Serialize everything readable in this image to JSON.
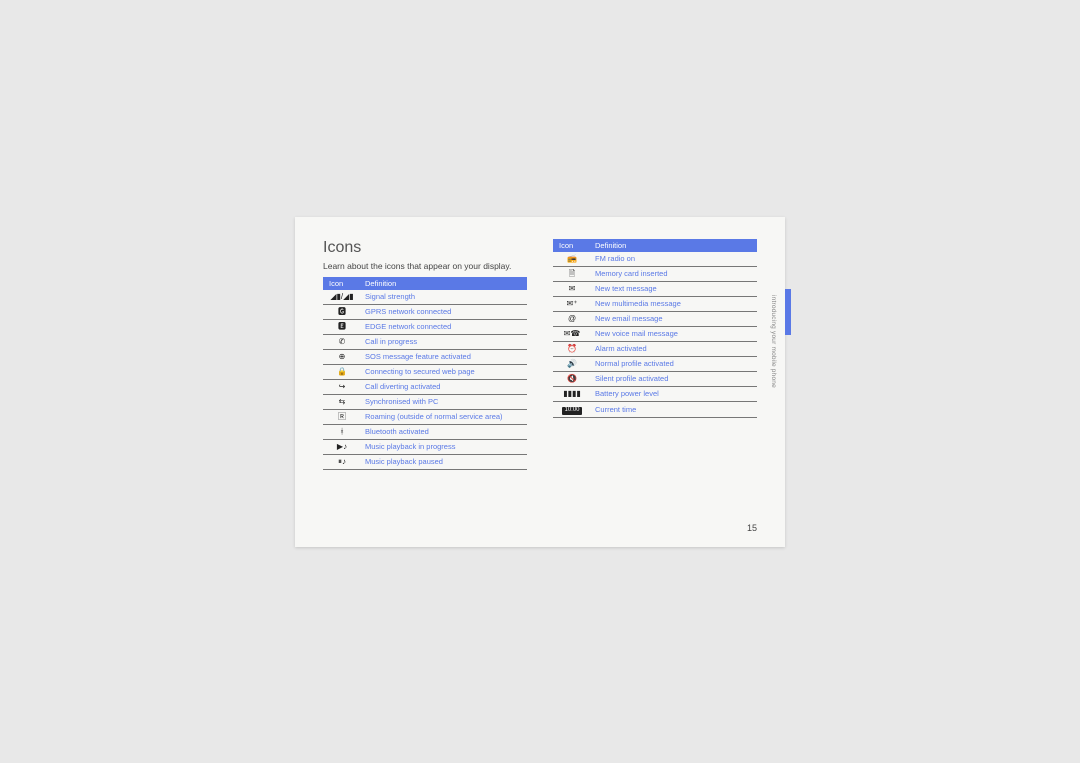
{
  "heading": "Icons",
  "subhead": "Learn about the icons that appear on your display.",
  "headers": {
    "icon": "Icon",
    "definition": "Definition"
  },
  "left_table": [
    {
      "icon": "signal-icon",
      "glyph": "◢▮/◢▮",
      "def": "Signal strength"
    },
    {
      "icon": "gprs-icon",
      "glyph": "🅶",
      "def": "GPRS network connected"
    },
    {
      "icon": "edge-icon",
      "glyph": "🅴",
      "def": "EDGE network connected"
    },
    {
      "icon": "call-icon",
      "glyph": "✆",
      "def": "Call in progress"
    },
    {
      "icon": "sos-icon",
      "glyph": "⊕",
      "def": "SOS message feature activated"
    },
    {
      "icon": "secure-icon",
      "glyph": "🔒",
      "def": "Connecting to secured web page"
    },
    {
      "icon": "divert-icon",
      "glyph": "↪",
      "def": "Call diverting activated"
    },
    {
      "icon": "sync-icon",
      "glyph": "⇆",
      "def": "Synchronised with PC"
    },
    {
      "icon": "roaming-icon",
      "glyph": "🅁",
      "def": "Roaming (outside of normal service area)"
    },
    {
      "icon": "bluetooth-icon",
      "glyph": "ᚼ",
      "def": "Bluetooth activated"
    },
    {
      "icon": "music-play-icon",
      "glyph": "▶♪",
      "def": "Music playback in progress"
    },
    {
      "icon": "music-pause-icon",
      "glyph": "⏸♪",
      "def": "Music playback paused"
    }
  ],
  "right_table": [
    {
      "icon": "radio-icon",
      "glyph": "📻",
      "def": "FM radio on"
    },
    {
      "icon": "memory-icon",
      "glyph": "🗎",
      "def": "Memory card inserted"
    },
    {
      "icon": "text-msg-icon",
      "glyph": "✉",
      "def": "New text message"
    },
    {
      "icon": "mms-icon",
      "glyph": "✉⁺",
      "def": "New multimedia message"
    },
    {
      "icon": "email-icon",
      "glyph": "@",
      "def": "New email message"
    },
    {
      "icon": "voicemail-icon",
      "glyph": "✉☎",
      "def": "New voice mail message"
    },
    {
      "icon": "alarm-icon",
      "glyph": "⏰",
      "def": "Alarm activated"
    },
    {
      "icon": "normal-prof-icon",
      "glyph": "🔊",
      "def": "Normal profile activated"
    },
    {
      "icon": "silent-prof-icon",
      "glyph": "🔇",
      "def": "Silent profile activated"
    },
    {
      "icon": "battery-icon",
      "glyph": "▮▮▮▮",
      "def": "Battery power level"
    },
    {
      "icon": "time-icon",
      "glyph": "10:00",
      "def": "Current time",
      "time_box": true
    }
  ],
  "side_label": "introducing your mobile phone",
  "page_number": "15"
}
